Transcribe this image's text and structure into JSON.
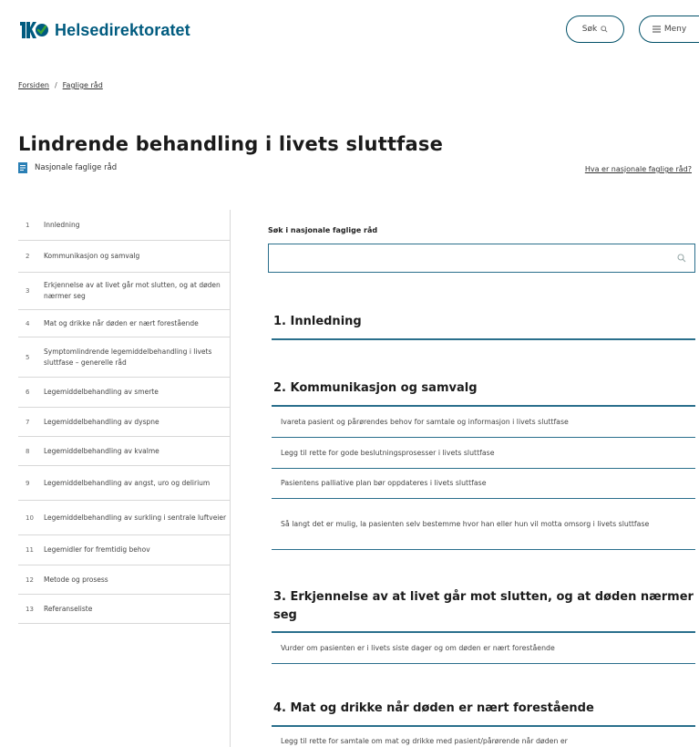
{
  "header": {
    "logo_text": "Helsedirektoratet",
    "search_label": "Søk",
    "menu_label": "Meny",
    "colors": {
      "brand": "#005b7f",
      "accent": "#2a6f8c",
      "logo_green": "#3aa535"
    }
  },
  "breadcrumb": {
    "items": [
      "Forsiden",
      "Faglige råd"
    ],
    "separator": "/"
  },
  "page": {
    "title": "Lindrende behandling i livets sluttfase",
    "doc_type": "Nasjonale faglige råd",
    "help_link": "Hva er nasjonale faglige råd?"
  },
  "sidebar": {
    "items": [
      {
        "num": "1",
        "label": "Innledning"
      },
      {
        "num": "2",
        "label": "Kommunikasjon og samvalg"
      },
      {
        "num": "3",
        "label": "Erkjennelse av at livet går mot slutten, og at døden nærmer seg"
      },
      {
        "num": "4",
        "label": "Mat og drikke når døden er nært forestående"
      },
      {
        "num": "5",
        "label": "Symptomlindrende legemiddelbehandling i livets sluttfase – generelle råd"
      },
      {
        "num": "6",
        "label": "Legemiddelbehandling av smerte"
      },
      {
        "num": "7",
        "label": "Legemiddelbehandling av dyspne"
      },
      {
        "num": "8",
        "label": "Legemiddelbehandling av kvalme"
      },
      {
        "num": "9",
        "label": "Legemiddelbehandling av angst, uro og delirium"
      },
      {
        "num": "10",
        "label": "Legemiddelbehandling av surkling i sentrale luftveier"
      },
      {
        "num": "11",
        "label": "Legemidler for fremtidig behov"
      },
      {
        "num": "12",
        "label": "Metode og prosess"
      },
      {
        "num": "13",
        "label": "Referanseliste"
      }
    ]
  },
  "search": {
    "label": "Søk i nasjonale faglige råd",
    "value": "",
    "placeholder": ""
  },
  "sections": [
    {
      "title": "1. Innledning",
      "recommendations": []
    },
    {
      "title": "2. Kommunikasjon og samvalg",
      "recommendations": [
        "Ivareta pasient og pårørendes behov for samtale og informasjon i livets sluttfase",
        "Legg til rette for gode beslutningsprosesser i livets sluttfase",
        "Pasientens palliative plan bør oppdateres i livets sluttfase",
        "Så langt det er mulig, la pasienten selv bestemme hvor han eller hun vil motta omsorg i livets sluttfase"
      ]
    },
    {
      "title": "3. Erkjennelse av at livet går mot slutten, og at døden nærmer seg",
      "recommendations": [
        "Vurder om pasienten er i livets siste dager og om døden er nært forestående"
      ]
    },
    {
      "title": "4. Mat og drikke når døden er nært forestående",
      "recommendations": [
        "Legg til rette for samtale om mat og drikke med pasient/pårørende når døden er"
      ]
    }
  ]
}
